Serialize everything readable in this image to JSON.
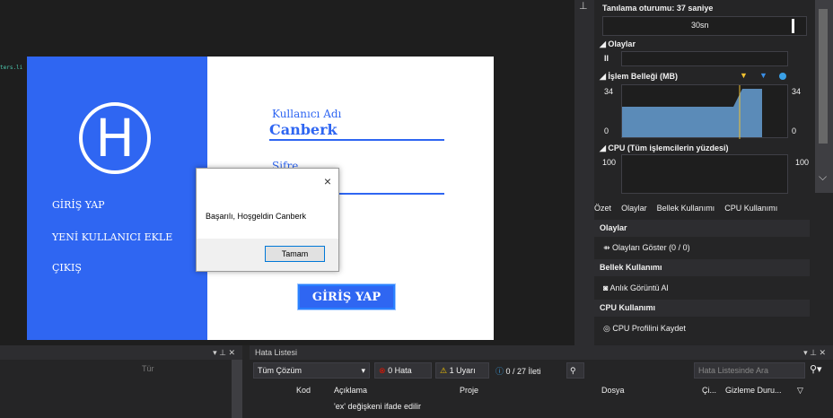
{
  "editor": {
    "code_fragment": "ters.li"
  },
  "app": {
    "logo_letter": "H",
    "menu": [
      "GİRİŞ YAP",
      "YENİ KULLANICI EKLE",
      "ÇIKIŞ"
    ],
    "username_label": "Kullanıcı Adı",
    "username_value": "Canberk",
    "password_label": "Şifre",
    "login_button": "GİRİŞ YAP"
  },
  "msgbox": {
    "close": "×",
    "text": "Başarılı, Hoşgeldin Canberk",
    "ok": "Tamam"
  },
  "diagnostics": {
    "session": "Tanılama oturumu: 37 saniye",
    "timeline_tick": "30sn",
    "events_title": "◢ Olaylar",
    "events_pause": "II",
    "memory_title": "◢ İşlem Belleği (MB)",
    "memory_max_left": "34",
    "memory_max_right": "34",
    "memory_min_left": "0",
    "memory_min_right": "0",
    "cpu_title": "◢ CPU (Tüm işlemcilerin yüzdesi)",
    "cpu_max_left": "100",
    "cpu_max_right": "100",
    "tabs": [
      "Özet",
      "Olaylar",
      "Bellek Kullanımı",
      "CPU Kullanımı"
    ],
    "sections": [
      {
        "title": "Olaylar",
        "item": "Olayları Göster (0 / 0)",
        "icon": "events-icon"
      },
      {
        "title": "Bellek Kullanımı",
        "item": "Anlık Görüntü Al",
        "icon": "camera-icon"
      },
      {
        "title": "CPU Kullanımı",
        "item": "CPU Profilini Kaydet",
        "icon": "record-icon"
      }
    ]
  },
  "bottom_left": {
    "col": "Tür"
  },
  "error_list": {
    "title": "Hata Listesi",
    "scope": "Tüm Çözüm",
    "errors": "0 Hata",
    "warnings": "1 Uyarı",
    "messages": "0 / 27 İleti",
    "search_placeholder": "Hata Listesinde Ara",
    "columns": [
      "Kod",
      "Açıklama",
      "Proje",
      "Dosya",
      "Çi...",
      "Gizleme Duru..."
    ],
    "row1": "'ex' değişkeni ifade edilir"
  },
  "colors": {
    "accent_blue": "#2f66f2",
    "chart_fill": "#5b8bb8"
  }
}
